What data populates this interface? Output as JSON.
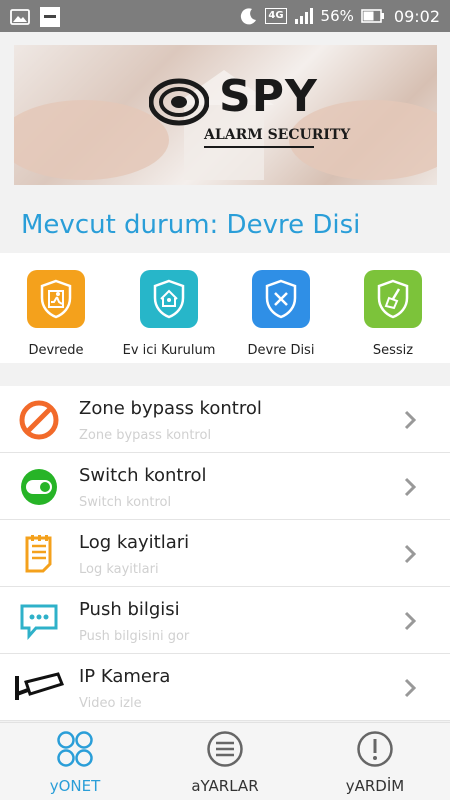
{
  "statusbar": {
    "network": "4G",
    "battery": "56%",
    "time": "09:02"
  },
  "banner": {
    "logo_main": "SPY",
    "logo_sub": "ALARM SECURITY"
  },
  "status": {
    "title": "Mevcut durum: Devre Disi"
  },
  "modes": [
    {
      "label": "Devrede",
      "color": "#f4a11c",
      "icon": "shield-person-icon"
    },
    {
      "label": "Ev ici Kurulum",
      "color": "#27b6c9",
      "icon": "shield-home-icon"
    },
    {
      "label": "Devre Disi",
      "color": "#2f8fe6",
      "icon": "shield-x-icon"
    },
    {
      "label": "Sessiz",
      "color": "#7cc33a",
      "icon": "shield-broom-icon"
    }
  ],
  "menu": [
    {
      "title": "Zone bypass kontrol",
      "subtitle": "Zone bypass kontrol",
      "icon": "prohibited-icon"
    },
    {
      "title": "Switch kontrol",
      "subtitle": "Switch kontrol",
      "icon": "toggle-switch-icon"
    },
    {
      "title": "Log kayitlari",
      "subtitle": "Log kayitlari",
      "icon": "log-document-icon"
    },
    {
      "title": "Push bilgisi",
      "subtitle": "Push bilgisini gor",
      "icon": "chat-bubble-icon"
    },
    {
      "title": "IP Kamera",
      "subtitle": "Video izle",
      "icon": "security-camera-icon"
    }
  ],
  "bottomnav": [
    {
      "label": "yONET",
      "active": true
    },
    {
      "label": "aYARLAR",
      "active": false
    },
    {
      "label": "yARDİM",
      "active": false
    }
  ],
  "colors": {
    "accent": "#2a9ed8",
    "statusbar": "#7d7d7d"
  }
}
